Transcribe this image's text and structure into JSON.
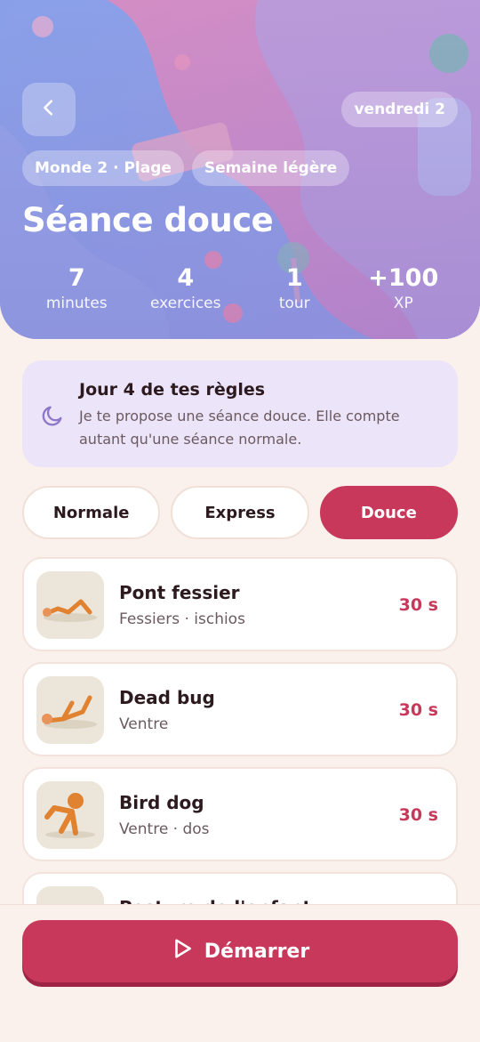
{
  "header": {
    "date": "vendredi 2",
    "tags": [
      "Monde 2 · Plage",
      "Semaine légère"
    ],
    "title": "Séance douce",
    "stats": [
      {
        "value": "7",
        "label": "minutes"
      },
      {
        "value": "4",
        "label": "exercices"
      },
      {
        "value": "1",
        "label": "tour"
      },
      {
        "value": "+100",
        "label": "XP"
      }
    ]
  },
  "info": {
    "title": "Jour 4 de tes règles",
    "text": "Je te propose une séance douce. Elle compte autant qu'une séance normale."
  },
  "modes": {
    "items": [
      "Normale",
      "Express",
      "Douce"
    ],
    "selected": "Douce"
  },
  "exercises": [
    {
      "name": "Pont fessier",
      "muscles": "Fessiers · ischios",
      "duration": "30 s"
    },
    {
      "name": "Dead bug",
      "muscles": "Ventre",
      "duration": "30 s"
    },
    {
      "name": "Bird dog",
      "muscles": "Ventre · dos",
      "duration": "30 s"
    },
    {
      "name": "Posture de l'enfant",
      "muscles": "",
      "duration": ""
    }
  ],
  "cta": {
    "label": "Démarrer"
  },
  "icons": {
    "back": "chevron-left-icon",
    "moon": "moon-icon",
    "play": "play-icon"
  },
  "colors": {
    "accent": "#c8385a",
    "background": "#fbf1ec",
    "info_bg": "#ece4f8",
    "moon": "#8e77c9"
  }
}
